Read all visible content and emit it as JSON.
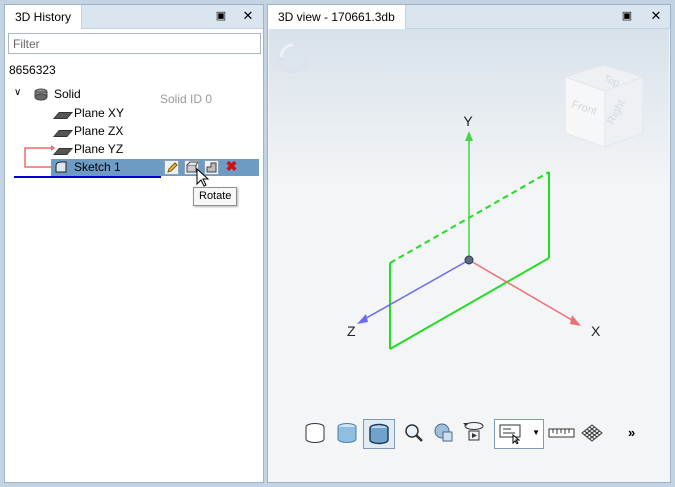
{
  "left_panel": {
    "tab_title": "3D History",
    "filter_placeholder": "Filter",
    "id_number": "8656323",
    "tree": {
      "solid_label": "Solid",
      "solid_id_text": "Solid ID 0",
      "items": [
        "Plane XY",
        "Plane ZX",
        "Plane YZ",
        "Sketch 1"
      ]
    },
    "tooltip": "Rotate"
  },
  "right_panel": {
    "tab_title": "3D view - 170661.3db",
    "viewcube": {
      "top": "Top",
      "front": "Front",
      "right": "Right"
    },
    "axes": {
      "x": "X",
      "y": "Y",
      "z": "Z"
    },
    "toolbar_more": "»"
  },
  "icons": {
    "collapse": "chevron-down-icon",
    "maximize": "maximize-icon",
    "close": "close-icon",
    "edit": "pencil-icon",
    "rotate": "rotate-icon",
    "extrude": "extrude-icon",
    "delete": "delete-icon"
  },
  "colors": {
    "x_axis": "#f07070",
    "y_axis": "#45d445",
    "z_axis": "#6b6bf0",
    "plane_outline": "#22dd22",
    "selection_bg": "#6e9bc4",
    "selection_underline": "#0000cc"
  }
}
